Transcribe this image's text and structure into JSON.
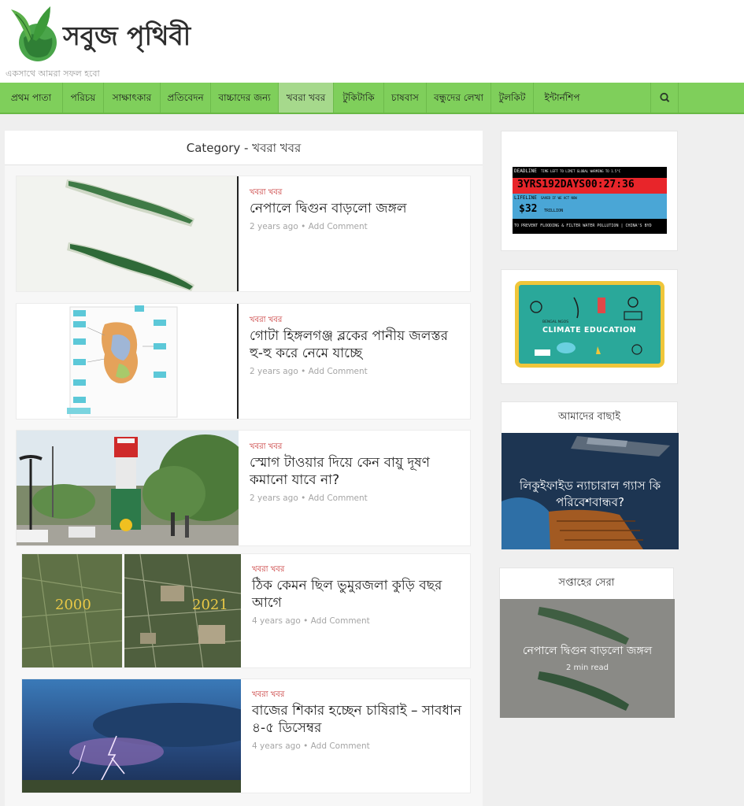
{
  "site": {
    "name": "সবুজ পৃথিবী",
    "tagline": "একসাথে আমরা সফল হবো"
  },
  "nav": {
    "items": [
      {
        "label": "প্রথম পাতা"
      },
      {
        "label": "পরিচয়"
      },
      {
        "label": "সাক্ষাৎকার"
      },
      {
        "label": "প্রতিবেদন"
      },
      {
        "label": "বাচ্চাদের জন্য"
      },
      {
        "label": "খবরা খবর"
      },
      {
        "label": "টুকিটাকি"
      },
      {
        "label": "চাষবাস"
      },
      {
        "label": "বন্ধুদের লেখা"
      },
      {
        "label": "টুলকিট"
      },
      {
        "label": "ইন্টার্নশিপ"
      }
    ],
    "active_index": 5,
    "search_icon": "search-icon"
  },
  "main": {
    "category_title": "Category - খবরা খবর",
    "posts": [
      {
        "category": "খবরা খবর",
        "title": "নেপালে দ্বিগুন বাড়লো জঙ্গল",
        "age": "2 years ago",
        "comment": "Add Comment",
        "thumb": "map-thumbnail"
      },
      {
        "category": "খবরা খবর",
        "title": "গোটা হিঙ্গলগঞ্জ ব্লকের পানীয় জলস্তর হু-হু করে নেমে যাচ্ছে",
        "age": "2 years ago",
        "comment": "Add Comment",
        "thumb": "groundwater-map-thumbnail"
      },
      {
        "category": "খবরা খবর",
        "title": "স্মোগ টাওয়ার দিয়ে কেন বায়ু দূষণ কমানো যাবে না?",
        "age": "2 years ago",
        "comment": "Add Comment",
        "thumb": "smog-tower-photo"
      },
      {
        "category": "খবরা খবর",
        "title": "ঠিক কেমন ছিল ভুমুরজলা কুড়ি বছর আগে",
        "age": "4 years ago",
        "comment": "Add Comment",
        "thumb": "satellite-comparison",
        "year_left": "2000",
        "year_right": "2021"
      },
      {
        "category": "খবরা খবর",
        "title": "বাজের শিকার হচ্ছেন চাষিরাই – সাবধান ৪-৫ ডিসেম্বর",
        "age": "4 years ago",
        "comment": "Add Comment",
        "thumb": "lightning-photo"
      }
    ],
    "meta_separator": "•"
  },
  "sidebar": {
    "climate_clock": {
      "deadline_label": "DEADLINE",
      "deadline_caption": "TIME LEFT TO LIMIT GLOBAL WARMING TO 1.5°C",
      "deadline_value": "3YRS192DAYS00:27:36",
      "lifeline_label": "LIFELINE",
      "lifeline_caption": "SAVED IF WE ACT NOW",
      "lifeline_value": "$32",
      "lifeline_unit": "TRILLION",
      "ticker": "TO PREVENT FLOODING & FILTER WATER POLLUTION | CHINA'S BYD"
    },
    "climate_education": {
      "small_label": "BENGAL NGOS",
      "label": "CLIMATE EDUCATION"
    },
    "our_pick": {
      "title": "আমাদের বাছাই",
      "headline": "লিকুইফাইড ন্যাচারাল গ্যাস কি পরিবেশবান্ধব?"
    },
    "week_best": {
      "title": "সপ্তাহের সেরা",
      "headline": "নেপালে দ্বিগুন বাড়লো জঙ্গল",
      "read_time": "2 min read"
    }
  },
  "colors": {
    "nav_bg": "#7fcf5b",
    "nav_active": "#a6d98c",
    "category_red": "#c62f2f",
    "meta_gray": "#a5a5a5"
  }
}
